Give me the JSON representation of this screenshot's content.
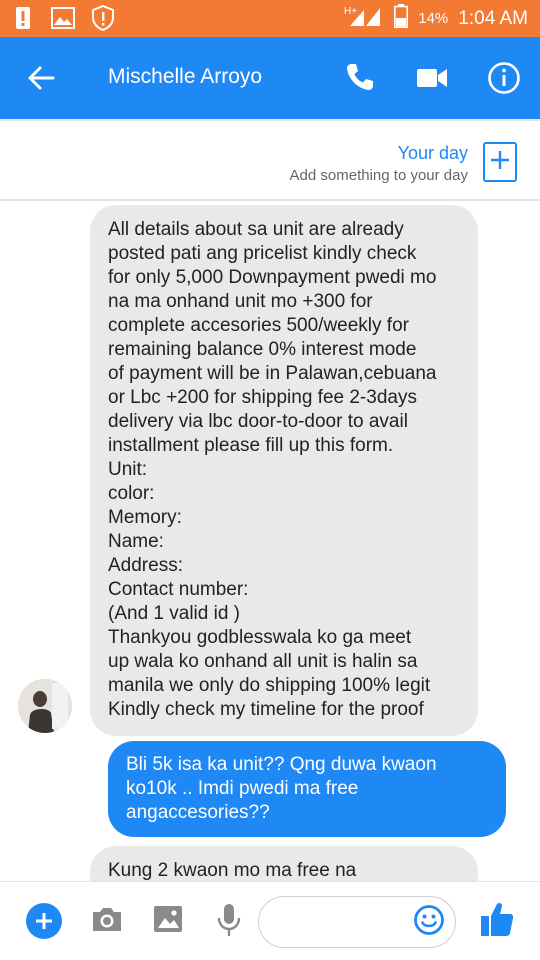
{
  "status_bar": {
    "battery_percent": "14%",
    "time": "1:04 AM",
    "network": "H+",
    "color": "#f37a33"
  },
  "header": {
    "title": "Mischelle Arroyo",
    "icons": [
      "back-arrow-icon",
      "phone-icon",
      "video-camera-icon",
      "info-icon"
    ],
    "color": "#1e88f5"
  },
  "your_day": {
    "title": "Your day",
    "subtitle": "Add something to your day"
  },
  "messages": [
    {
      "direction": "incoming",
      "lines": [
        "All details about sa unit are already",
        "posted pati ang pricelist kindly check",
        "for only 5,000 Downpayment pwedi mo",
        "na ma onhand unit mo +300 for",
        "complete accesories 500/weekly for",
        "remaining balance 0% interest mode",
        "of payment will be in Palawan,cebuana",
        "or Lbc +200 for shipping fee 2-3days",
        "delivery via lbc door-to-door to avail",
        "installment please fill up this form.",
        "Unit:",
        "color:",
        "Memory:",
        "Name:",
        "Address:",
        "Contact number:",
        "(And 1 valid id )",
        "Thankyou godblesswala ko ga meet",
        "up wala ko onhand all unit is halin sa",
        "manila we only do shipping 100% legit",
        "Kindly check my timeline for the proof"
      ]
    },
    {
      "direction": "outgoing",
      "lines": [
        "Bli 5k isa ka unit??  Qng duwa kwaon ko",
        "10k .. Imdi pwedi ma free ang",
        "accesories??"
      ]
    },
    {
      "direction": "incoming",
      "lines": [
        "Kung 2 kwaon mo ma free na"
      ]
    }
  ],
  "composer": {
    "input_value": "",
    "icons": [
      "plus-icon",
      "camera-icon",
      "image-icon",
      "microphone-icon",
      "emoji-icon",
      "thumbs-up-icon"
    ]
  }
}
